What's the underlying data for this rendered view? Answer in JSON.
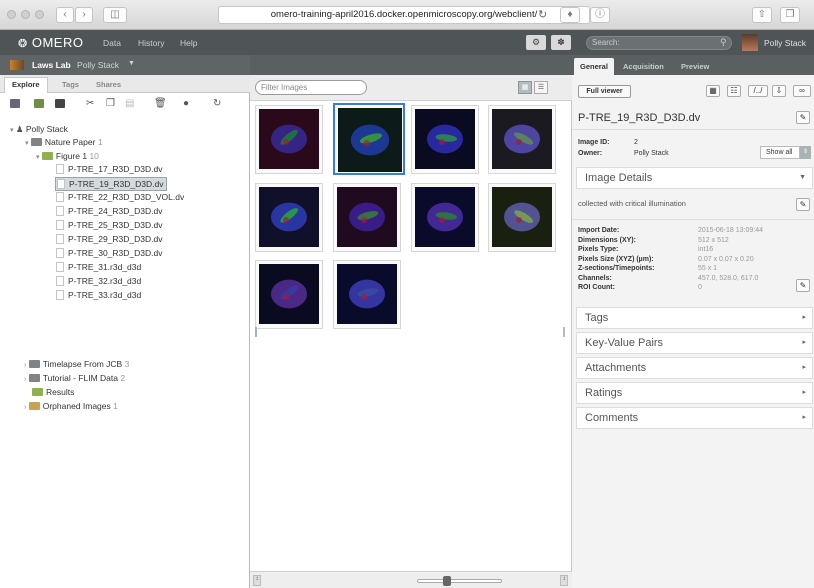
{
  "browser": {
    "url": "omero-training-april2016.docker.openmicroscopy.org/webclient/"
  },
  "topbar": {
    "logo": "OMERO",
    "menu": [
      "Data",
      "History",
      "Help"
    ],
    "search_placeholder": "Search:",
    "user": "Polly Stack"
  },
  "left": {
    "group": "Laws Lab",
    "user": "Polly Stack",
    "tabs": [
      "Explore",
      "Tags",
      "Shares"
    ],
    "tree": {
      "root": "Polly Stack",
      "project": "Nature Paper",
      "project_count": "1",
      "dataset": "Figure 1",
      "dataset_count": "10",
      "images": [
        "P-TRE_17_R3D_D3D.dv",
        "P-TRE_19_R3D_D3D.dv",
        "P-TRE_22_R3D_D3D_VOL.dv",
        "P-TRE_24_R3D_D3D.dv",
        "P-TRE_25_R3D_D3D.dv",
        "P-TRE_29_R3D_D3D.dv",
        "P-TRE_30_R3D_D3D.dv",
        "P-TRE_31.r3d_d3d",
        "P-TRE_32.r3d_d3d",
        "P-TRE_33.r3d_d3d"
      ],
      "others": [
        {
          "name": "Timelapse From JCB",
          "count": "3",
          "color": "#8a8f92"
        },
        {
          "name": "Tutorial - FLIM Data",
          "count": "2",
          "color": "#8a8f92"
        },
        {
          "name": "Results",
          "count": "",
          "color": "#9bbb59"
        },
        {
          "name": "Orphaned Images",
          "count": "1",
          "color": "#c9a25a"
        }
      ]
    }
  },
  "center": {
    "filter_placeholder": "Filter Images"
  },
  "right": {
    "tabs": [
      "General",
      "Acquisition",
      "Preview"
    ],
    "full_viewer": "Full viewer",
    "image_name": "P-TRE_19_R3D_D3D.dv",
    "image_id_label": "Image ID:",
    "image_id": "2",
    "owner_label": "Owner:",
    "owner": "Polly Stack",
    "show_all": "Show all",
    "details_title": "Image Details",
    "description": "collected with critical illumination",
    "fields": [
      {
        "label": "Import Date:",
        "value": "2015-06-18 13:09:44"
      },
      {
        "label": "Dimensions (XY):",
        "value": "512 x 512"
      },
      {
        "label": "Pixels Type:",
        "value": "int16"
      },
      {
        "label": "Pixels Size (XYZ) (µm):",
        "value": "0.07 x 0.07 x 0.20"
      },
      {
        "label": "Z-sections/Timepoints:",
        "value": "55 x 1"
      },
      {
        "label": "Channels:",
        "value": "457.0, 528.0, 617.0"
      },
      {
        "label": "ROI Count:",
        "value": "0"
      }
    ],
    "sections": [
      "Tags",
      "Key-Value Pairs",
      "Attachments",
      "Ratings",
      "Comments"
    ]
  }
}
